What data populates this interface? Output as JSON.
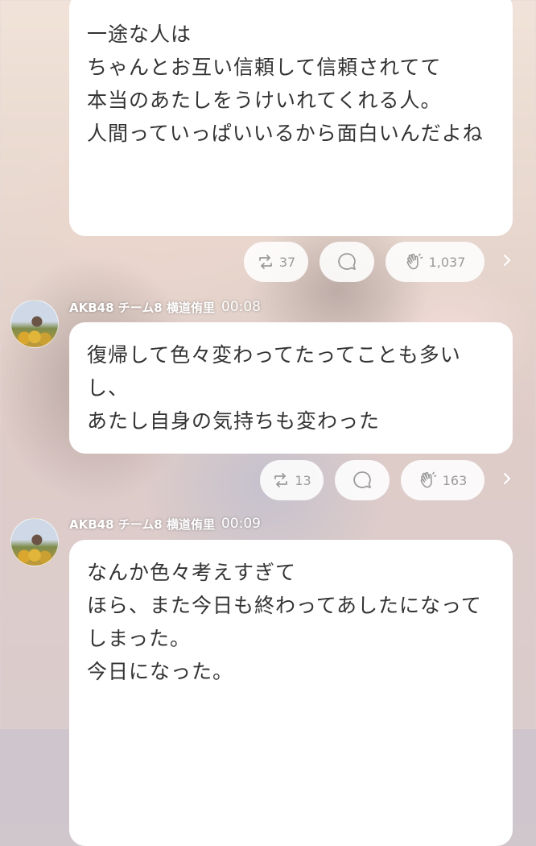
{
  "messages": [
    {
      "lines": [
        "一途な人は",
        "ちゃんとお互い信頼して信頼されてて",
        "本当のあたしをうけいれてくれる人。",
        "",
        "",
        "人間っていっぱいいるから面白いんだよね"
      ],
      "actions": {
        "repost_count": "37",
        "clap_count": "1,037"
      }
    },
    {
      "author": "AKB48 チーム8 横道侑里",
      "time": "00:08",
      "lines": [
        "復帰して色々変わってたってことも多い",
        "し、",
        "あたし自身の気持ちも変わった"
      ],
      "actions": {
        "repost_count": "13",
        "clap_count": "163"
      }
    },
    {
      "author": "AKB48 チーム8 横道侑里",
      "time": "00:09",
      "lines": [
        "なんか色々考えすぎて",
        "",
        "",
        "",
        "ほら、また今日も終わってあしたになって",
        "しまった。",
        "今日になった。"
      ]
    }
  ],
  "icons": {
    "repost": "repost-icon",
    "comment": "comment-bubble-icon",
    "clap": "clap-hand-icon",
    "more": "chevron-right-icon"
  },
  "colors": {
    "bubble": "#ffffff",
    "text": "#333333",
    "pill_text": "#9a9a9a"
  }
}
